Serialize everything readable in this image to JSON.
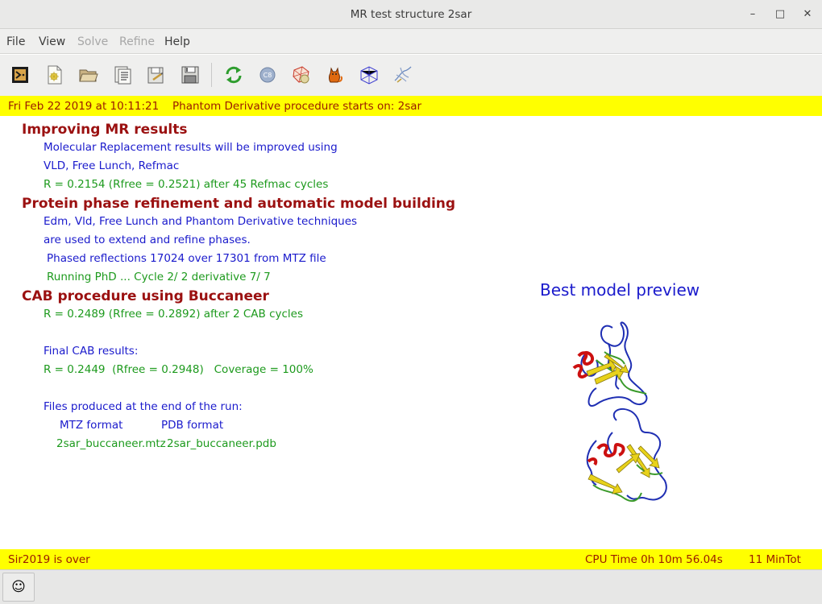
{
  "window": {
    "title": "MR test structure  2sar",
    "controls": {
      "minimize": "–",
      "maximize": "□",
      "close": "✕"
    }
  },
  "menubar": {
    "items": [
      {
        "label": "File",
        "enabled": true
      },
      {
        "label": "View",
        "enabled": true
      },
      {
        "label": "Solve",
        "enabled": false
      },
      {
        "label": "Refine",
        "enabled": false
      },
      {
        "label": "Help",
        "enabled": true
      }
    ]
  },
  "toolbar": {
    "icons": [
      "exit-icon",
      "new-file-icon",
      "open-folder-icon",
      "document-list-icon",
      "save-as-icon",
      "save-icon",
      "refresh-icon",
      "c8-icon",
      "molecule-icon",
      "cat-icon",
      "crystal-cell-icon",
      "structure-icon"
    ]
  },
  "status_top": {
    "datetime": "Fri Feb 22  2019 at 10:11:21",
    "message": "Phantom Derivative procedure starts on: 2sar"
  },
  "content": {
    "sec1_title": "Improving MR results",
    "sec1_l1": "Molecular Replacement results will be improved using",
    "sec1_l2": "VLD, Free Lunch, Refmac",
    "sec1_l3": "R = 0.2154 (Rfree = 0.2521) after 45 Refmac cycles",
    "sec2_title": "Protein phase refinement and automatic model building",
    "sec2_l1": "Edm, Vld, Free Lunch and Phantom Derivative techniques",
    "sec2_l2": "are used to extend and refine phases.",
    "sec2_l3": "Phased reflections 17024 over 17301 from MTZ file",
    "sec2_l4": "Running PhD ... Cycle 2/ 2 derivative 7/ 7",
    "sec3_title": "CAB procedure using Buccaneer",
    "sec3_l1": "R = 0.2489 (Rfree = 0.2892) after 2 CAB cycles",
    "final_label": "Final CAB results:",
    "final_values": "R = 0.2449  (Rfree = 0.2948)   Coverage = 100%",
    "files_label": "Files produced at the end of the run:",
    "mtz_header": "MTZ format",
    "pdb_header": "PDB format",
    "mtz_file": "2sar_buccaneer.mtz",
    "pdb_file": "2sar_buccaneer.pdb",
    "preview_title": "Best model preview"
  },
  "status_bottom": {
    "message": "Sir2019 is over",
    "cpu_time": "CPU Time   0h 10m 56.04s",
    "min_tot": "11 MinTot"
  },
  "bottom": {
    "smiley": "☺"
  },
  "colors": {
    "heading": "#9b1111",
    "info": "#1a1acc",
    "result": "#1d9a1d",
    "status_bg": "#ffff00",
    "status_text": "#9a1a00"
  }
}
